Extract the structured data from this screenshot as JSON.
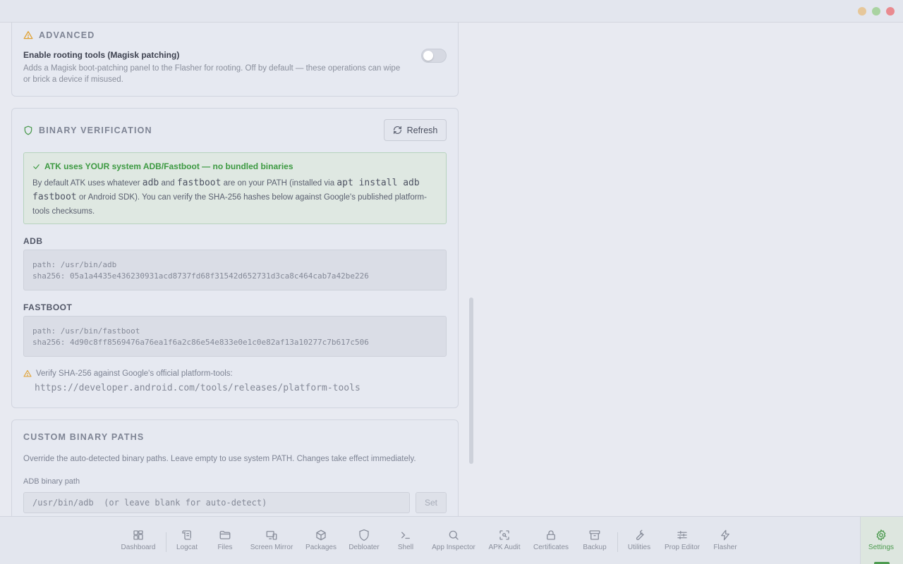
{
  "window": {
    "controls": [
      "minimize",
      "maximize",
      "close"
    ]
  },
  "advanced": {
    "title": "ADVANCED",
    "setting_label": "Enable rooting tools (Magisk patching)",
    "setting_description": "Adds a Magisk boot-patching panel to the Flasher for rooting. Off by default — these operations can wipe or brick a device if misused.",
    "toggle_on": false
  },
  "binary_verification": {
    "title": "BINARY VERIFICATION",
    "refresh_label": "Refresh",
    "notice_title": "ATK uses YOUR system ADB/Fastboot — no bundled binaries",
    "notice_text_1": "By default ATK uses whatever ",
    "notice_code_adb": "adb",
    "notice_text_2": " and ",
    "notice_code_fastboot": "fastboot",
    "notice_text_3": " are on your PATH (installed via ",
    "notice_code_apt": "apt install adb fastboot",
    "notice_text_4": " or Android SDK). You can verify the SHA-256 hashes below against Google's published platform-tools checksums.",
    "adb_label": "ADB",
    "adb_info": "path: /usr/bin/adb\nsha256: 05a1a4435e436230931acd8737fd68f31542d652731d3ca8c464cab7a42be226",
    "fastboot_label": "FASTBOOT",
    "fastboot_info": "path: /usr/bin/fastboot\nsha256: 4d90c8ff8569476a76ea1f6a2c86e54e833e0e1c0e82af13a10277c7b617c506",
    "verify_text": "Verify SHA-256 against Google's official platform-tools:",
    "verify_url": "https://developer.android.com/tools/releases/platform-tools"
  },
  "custom_paths": {
    "title": "CUSTOM BINARY PATHS",
    "description": "Override the auto-detected binary paths. Leave empty to use system PATH. Changes take effect immediately.",
    "adb_path_label": "ADB binary path",
    "adb_path_value": "",
    "adb_path_placeholder": "/usr/bin/adb  (or leave blank for auto-detect)",
    "set_label": "Set"
  },
  "nav": {
    "items": [
      {
        "label": "Dashboard",
        "icon": "dashboard-icon"
      },
      {
        "label": "Logcat",
        "icon": "scroll-icon"
      },
      {
        "label": "Files",
        "icon": "folder-icon"
      },
      {
        "label": "Screen Mirror",
        "icon": "monitor-icon"
      },
      {
        "label": "Packages",
        "icon": "package-icon"
      },
      {
        "label": "Debloater",
        "icon": "shield-icon"
      },
      {
        "label": "Shell",
        "icon": "terminal-icon"
      },
      {
        "label": "App Inspector",
        "icon": "search-icon"
      },
      {
        "label": "APK Audit",
        "icon": "scan-icon"
      },
      {
        "label": "Certificates",
        "icon": "lock-icon"
      },
      {
        "label": "Backup",
        "icon": "archive-icon"
      },
      {
        "label": "Utilities",
        "icon": "wrench-icon"
      },
      {
        "label": "Prop Editor",
        "icon": "sliders-icon"
      },
      {
        "label": "Flasher",
        "icon": "zap-icon"
      },
      {
        "label": "Settings",
        "icon": "gear-icon"
      }
    ],
    "active": "Settings"
  },
  "colors": {
    "accent_green": "#4b9a4e",
    "warning_amber": "#e0a030",
    "window_close": "#e98a8f",
    "window_min": "#e6c79a",
    "window_max": "#a9d3a1"
  }
}
